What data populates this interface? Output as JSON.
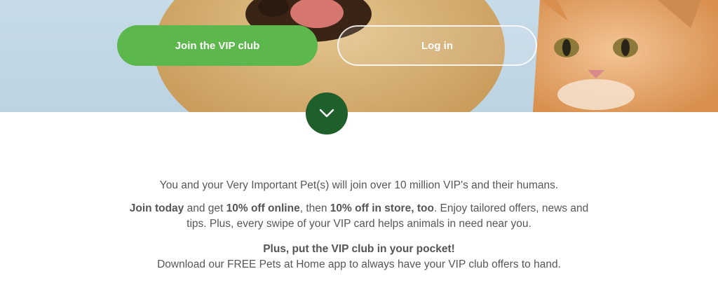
{
  "hero": {
    "join_label": "Join the VIP club",
    "login_label": "Log in",
    "scroll_icon": "chevron-down-icon"
  },
  "intro": {
    "line1": "You and your Very Important Pet(s) will join over 10 million VIP's and their humans.",
    "join_today": "Join today",
    "and_get": " and get ",
    "ten_online": "10% off online",
    "then": ", then ",
    "ten_store": "10% off in store, too",
    "enjoy": ". Enjoy tailored offers, news and",
    "line3": "tips. Plus, every swipe of your VIP card helps animals in need near you.",
    "pocket_title": "Plus, put the VIP club in your pocket!",
    "pocket_text": "Download our FREE Pets at Home app to always have your VIP club offers to hand."
  },
  "colors": {
    "join_green": "#5cb84c",
    "chevron_green": "#1f5f2c",
    "text_grey": "#575757"
  }
}
